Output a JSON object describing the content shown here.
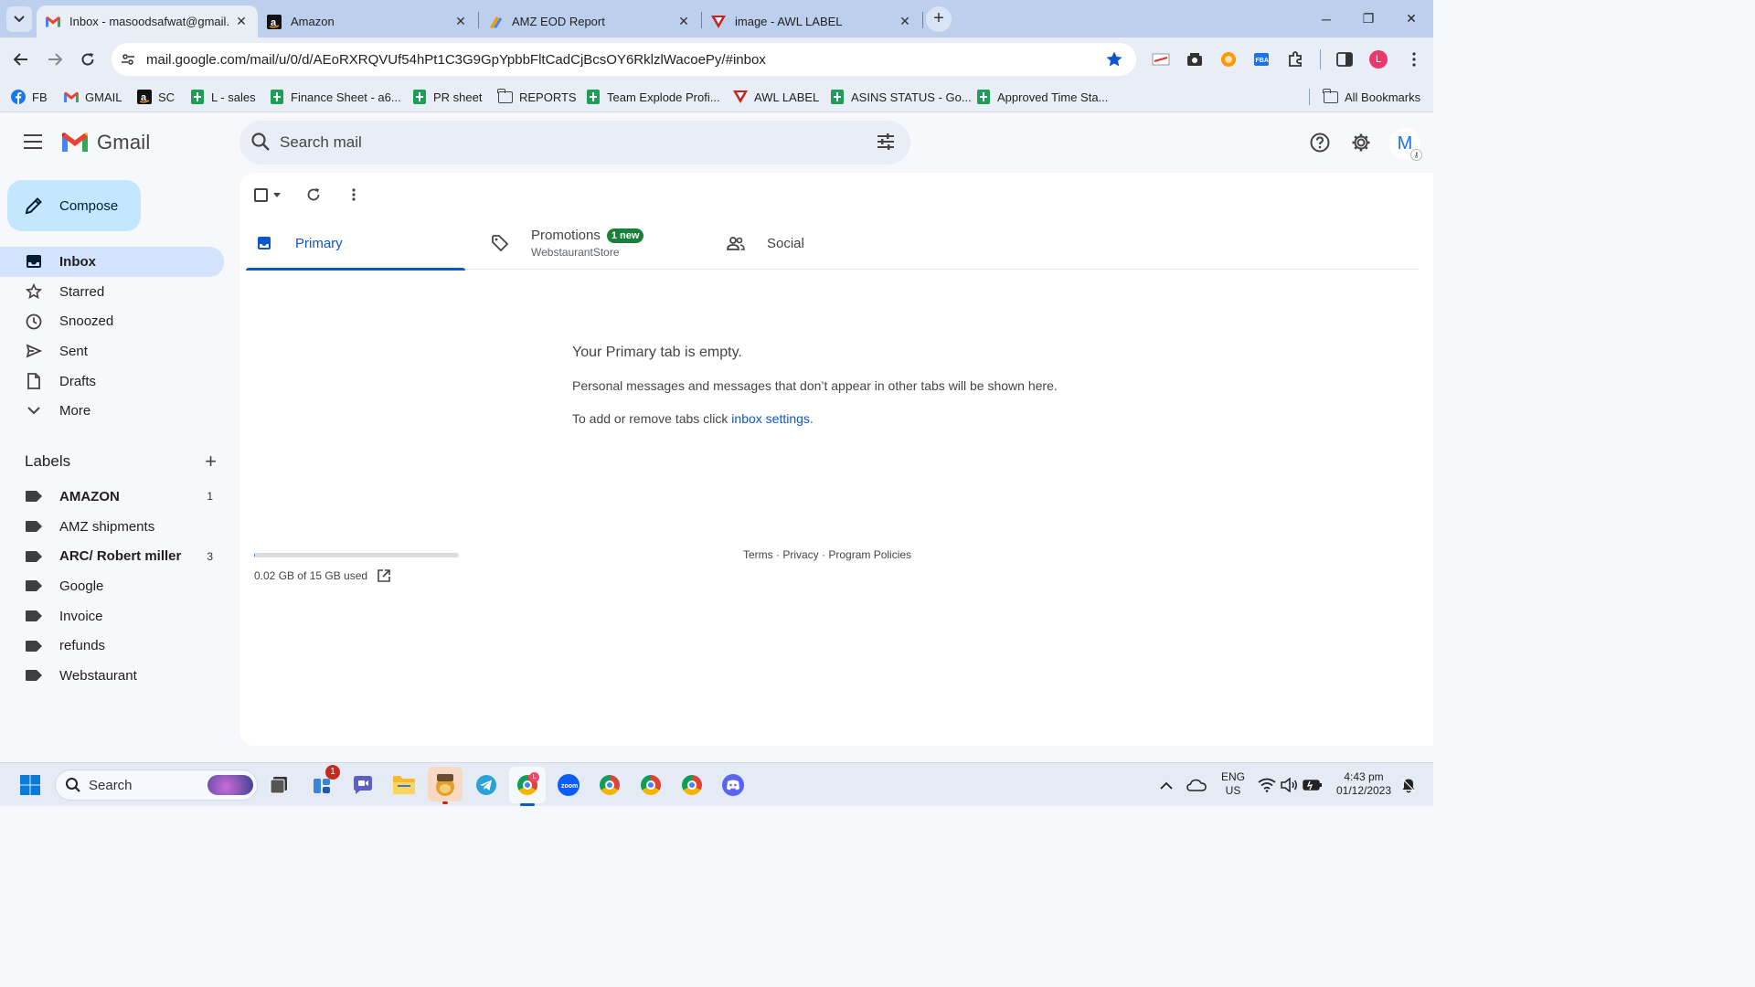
{
  "browser": {
    "tabs": [
      {
        "title": "Inbox - masoodsafwat@gmail.",
        "active": true
      },
      {
        "title": "Amazon",
        "active": false
      },
      {
        "title": "AMZ EOD Report",
        "active": false
      },
      {
        "title": "image - AWL LABEL",
        "active": false
      }
    ],
    "url": "mail.google.com/mail/u/0/d/AEoRXRQVUf54hPt1C3G9GpYpbbFltCadCjBcsOY6RklzlWacoePy/#inbox",
    "profile_initial": "L",
    "bookmarks": [
      {
        "label": "FB",
        "icon": "facebook-icon"
      },
      {
        "label": "GMAIL",
        "icon": "gmail-icon"
      },
      {
        "label": "SC",
        "icon": "amazon-icon"
      },
      {
        "label": "L - sales",
        "icon": "sheets-icon"
      },
      {
        "label": "Finance Sheet - a6...",
        "icon": "sheets-icon"
      },
      {
        "label": "PR sheet",
        "icon": "sheets-icon"
      },
      {
        "label": "REPORTS",
        "icon": "folder-icon"
      },
      {
        "label": "Team Explode Profi...",
        "icon": "sheets-icon"
      },
      {
        "label": "AWL LABEL",
        "icon": "awl-icon"
      },
      {
        "label": "ASINS STATUS - Go...",
        "icon": "sheets-icon"
      },
      {
        "label": "Approved Time Sta...",
        "icon": "sheets-icon"
      }
    ],
    "all_bookmarks": "All Bookmarks"
  },
  "gmail": {
    "product_name": "Gmail",
    "search_placeholder": "Search mail",
    "avatar_initial": "M",
    "compose_label": "Compose",
    "nav": [
      {
        "label": "Inbox",
        "icon": "inbox-icon",
        "active": true
      },
      {
        "label": "Starred",
        "icon": "star-icon",
        "active": false
      },
      {
        "label": "Snoozed",
        "icon": "clock-icon",
        "active": false
      },
      {
        "label": "Sent",
        "icon": "send-icon",
        "active": false
      },
      {
        "label": "Drafts",
        "icon": "draft-icon",
        "active": false
      },
      {
        "label": "More",
        "icon": "chevron-down-icon",
        "active": false
      }
    ],
    "labels_title": "Labels",
    "labels": [
      {
        "label": "AMAZON",
        "count": "1",
        "bold": true
      },
      {
        "label": "AMZ shipments",
        "count": "",
        "bold": false
      },
      {
        "label": "ARC/ Robert miller",
        "count": "3",
        "bold": true
      },
      {
        "label": "Google",
        "count": "",
        "bold": false
      },
      {
        "label": "Invoice",
        "count": "",
        "bold": false
      },
      {
        "label": "refunds",
        "count": "",
        "bold": false
      },
      {
        "label": "Webstaurant",
        "count": "",
        "bold": false
      }
    ],
    "tabs": {
      "primary": "Primary",
      "promotions": "Promotions",
      "promotions_badge": "1 new",
      "promotions_sender": "WebstaurantStore",
      "social": "Social"
    },
    "empty": {
      "title": "Your Primary tab is empty.",
      "body": "Personal messages and messages that don’t appear in other tabs will be shown here.",
      "settings_prefix": "To add or remove tabs click ",
      "settings_link": "inbox settings",
      "settings_suffix": "."
    },
    "storage": {
      "text": "0.02 GB of 15 GB used",
      "used_fraction": 0.0013
    },
    "footer": {
      "terms": "Terms",
      "privacy": "Privacy",
      "policies": "Program Policies",
      "sep": " · "
    }
  },
  "taskbar": {
    "search_placeholder": "Search",
    "store_badge": "1",
    "lang_top": "ENG",
    "lang_bottom": "US",
    "time": "4:43 pm",
    "date": "01/12/2023"
  }
}
